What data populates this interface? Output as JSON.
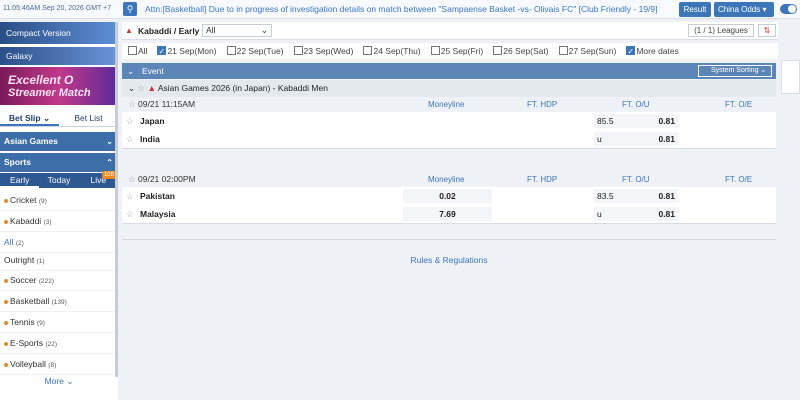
{
  "topbar": {
    "clock": "11:05:46AM Sep 20, 2026 GMT +7",
    "notice": "Attn:[Basketball] Due to in progress of investigation details on match between \"Sampaense Basket -vs- Olivais FC\" [Club Friendly - 19/9]",
    "result_label": "Result",
    "odds_label": "China Odds",
    "search_icon": "search-icon"
  },
  "sidebar": {
    "compact_label": "Compact Version",
    "galaxy_label": "Galaxy",
    "banner_line1": "Excellent O",
    "banner_line2": "Streamer Match",
    "bet_slip": "Bet Slip",
    "bet_list": "Bet List",
    "asian_games": "Asian Games",
    "sports": "Sports",
    "day_early": "Early",
    "day_today": "Today",
    "day_live": "Live",
    "live_badge": "108",
    "items": [
      {
        "name": "Cricket",
        "count": "(9)"
      },
      {
        "name": "Kabaddi",
        "count": "(3)"
      },
      {
        "name": "All",
        "count": "(2)"
      },
      {
        "name": "Outright",
        "count": "(1)"
      },
      {
        "name": "Soccer",
        "count": "(222)"
      },
      {
        "name": "Basketball",
        "count": "(139)"
      },
      {
        "name": "Tennis",
        "count": "(9)"
      },
      {
        "name": "E-Sports",
        "count": "(22)"
      },
      {
        "name": "Volleyball",
        "count": "(8)"
      }
    ],
    "more": "More"
  },
  "main": {
    "title": "Kabaddi / Early",
    "filter": "All",
    "leagues": "(1 / 1) Leagues",
    "dates": [
      {
        "label": "All",
        "checked": false
      },
      {
        "label": "21 Sep(Mon)",
        "checked": true
      },
      {
        "label": "22 Sep(Tue)",
        "checked": false
      },
      {
        "label": "23 Sep(Wed)",
        "checked": false
      },
      {
        "label": "24 Sep(Thu)",
        "checked": false
      },
      {
        "label": "25 Sep(Fri)",
        "checked": false
      },
      {
        "label": "26 Sep(Sat)",
        "checked": false
      },
      {
        "label": "27 Sep(Sun)",
        "checked": false
      },
      {
        "label": "More dates",
        "checked": true
      }
    ],
    "event_label": "Event",
    "system_sorting": "System Sorting",
    "league_name": "Asian Games 2026 (in Japan) - Kabaddi Men",
    "columns": [
      "Moneyline",
      "FT. HDP",
      "FT. O/U",
      "FT. O/E"
    ],
    "matches": [
      {
        "time": "09/21 11:15AM",
        "home": "Japan",
        "away": "India",
        "home_ml": "",
        "away_ml": "",
        "ou_line_home": "85.5",
        "ou_home": "0.81",
        "ou_line_away": "u",
        "ou_away": "0.81"
      },
      {
        "time": "09/21 02:00PM",
        "home": "Pakistan",
        "away": "Malaysia",
        "home_ml": "0.02",
        "away_ml": "7.69",
        "ou_line_home": "83.5",
        "ou_home": "0.81",
        "ou_line_away": "u",
        "ou_away": "0.81"
      }
    ],
    "rules": "Rules & Regulations"
  }
}
